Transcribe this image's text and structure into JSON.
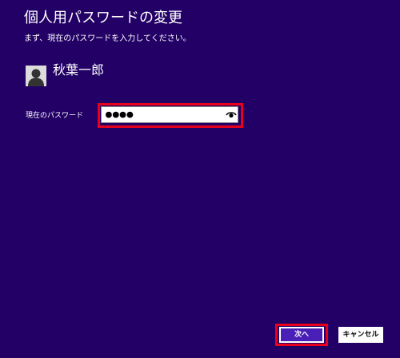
{
  "header": {
    "title": "個人用パスワードの変更",
    "instruction": "まず、現在のパスワードを入力してください。"
  },
  "user": {
    "name": "秋葉一郎",
    "avatar_icon": "user-silhouette-icon"
  },
  "form": {
    "current_password_label": "現在のパスワード",
    "current_password_value": "●●●●",
    "reveal_icon": "eye-icon"
  },
  "footer": {
    "next_label": "次へ",
    "cancel_label": "キャンセル"
  },
  "colors": {
    "background": "#220066",
    "highlight": "#e8001c",
    "primary_button": "#4a1fb8"
  }
}
